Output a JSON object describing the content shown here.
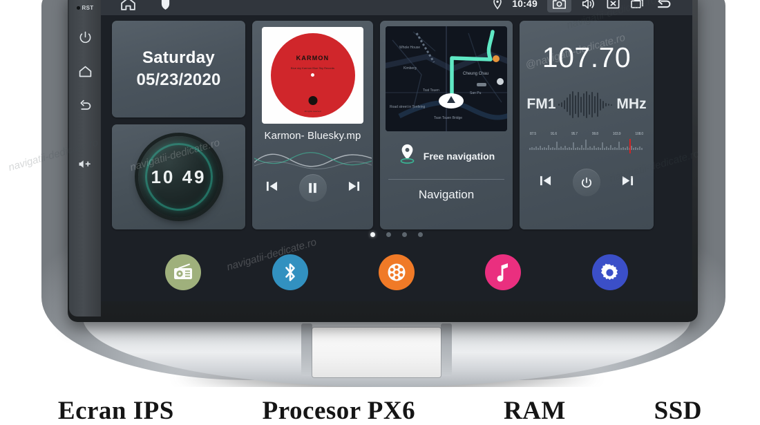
{
  "device": {
    "bezel": {
      "reset_label": "RST",
      "buttons": [
        {
          "name": "power-button",
          "icon": "power-icon"
        },
        {
          "name": "home-button",
          "icon": "home-icon"
        },
        {
          "name": "back-button",
          "icon": "back-arrow-icon"
        },
        {
          "name": "volume-up-button",
          "icon": "volume-up-icon"
        }
      ]
    }
  },
  "statusbar": {
    "left_icons": [
      {
        "name": "home-icon",
        "label": "Home"
      },
      {
        "name": "shield-icon",
        "label": "Shield"
      }
    ],
    "location_icon": "location-pin-icon",
    "time": "10:49",
    "right_icons": [
      {
        "name": "camera-icon",
        "label": "Screenshot",
        "highlighted": true
      },
      {
        "name": "volume-icon",
        "label": "Volume"
      },
      {
        "name": "close-box-icon",
        "label": "Close"
      },
      {
        "name": "recents-icon",
        "label": "Recents"
      },
      {
        "name": "back-arrow-icon",
        "label": "Back"
      }
    ]
  },
  "widgets": {
    "date": {
      "day": "Saturday",
      "date": "05/23/2020"
    },
    "clock": {
      "time": "10 49",
      "ring_color": "#2aa08a"
    },
    "music": {
      "album_brand": "KARMON",
      "album_sub": "Blue sky\nKarmon\nBlue Sky Records",
      "album_foot": "All rights reserved",
      "album_color": "#d0262b",
      "track_title": "Karmon- Bluesky.mp",
      "controls": [
        {
          "name": "previous-track-button",
          "icon": "skip-previous-icon"
        },
        {
          "name": "pause-button",
          "icon": "pause-icon"
        },
        {
          "name": "next-track-button",
          "icon": "skip-next-icon"
        }
      ]
    },
    "navigation": {
      "free_nav_label": "Free navigation",
      "title": "Navigation",
      "route_color": "#5fe8c4",
      "map_labels": [
        "Whole House",
        "Kimberg",
        "Tsat Tsuen",
        "Cheung Chau",
        "San Pu",
        "Tsan Tsuen Bridge",
        "Road street in Tonfeing"
      ]
    },
    "radio": {
      "frequency": "107.70",
      "band": "FM1",
      "unit": "MHz",
      "scale_ticks": [
        "87.5",
        "91.6",
        "95.7",
        "99.8",
        "103.9",
        "108.0"
      ],
      "tuner_marker_color": "#e02020",
      "controls": [
        {
          "name": "previous-station-button",
          "icon": "skip-previous-icon"
        },
        {
          "name": "radio-power-button",
          "icon": "power-icon"
        },
        {
          "name": "next-station-button",
          "icon": "skip-next-icon"
        }
      ]
    }
  },
  "pager": {
    "count": 4,
    "active": 0
  },
  "dock": {
    "apps": [
      {
        "name": "app-radio",
        "label": "Radio",
        "icon": "radio-icon",
        "color": "#9fb07c"
      },
      {
        "name": "app-bluetooth",
        "label": "Bluetooth",
        "icon": "bluetooth-icon",
        "color": "#3291c0"
      },
      {
        "name": "app-video",
        "label": "Video",
        "icon": "film-reel-icon",
        "color": "#f07a27"
      },
      {
        "name": "app-music",
        "label": "Music",
        "icon": "music-note-icon",
        "color": "#ea2f7f"
      },
      {
        "name": "app-settings",
        "label": "Settings",
        "icon": "gear-icon",
        "color": "#3b4fc8"
      }
    ]
  },
  "watermarks": [
    "@navigatii-dedicate.ro",
    "navigatii-dedicate.ro",
    "navigatii-dedicate.ro",
    "navigatii-dedicate.ro",
    "navigatii-dedicate.ro",
    "navigatii-dedicate.ro"
  ],
  "banner": {
    "items": [
      "Ecran IPS",
      "Procesor PX6",
      "RAM",
      "SSD"
    ]
  }
}
